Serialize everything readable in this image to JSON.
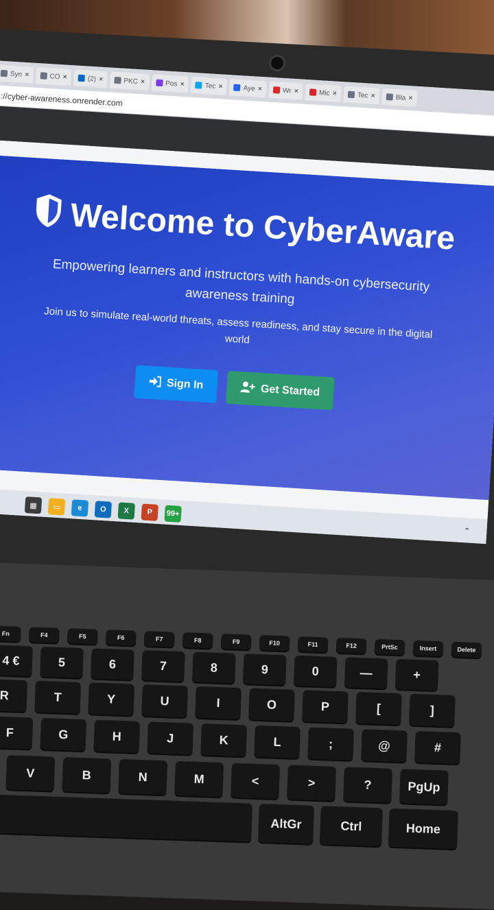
{
  "browser": {
    "tabs": [
      {
        "label": "Syn",
        "color": "#6b7280"
      },
      {
        "label": "CO",
        "color": "#6b7280"
      },
      {
        "label": "(2)",
        "color": "#0a66c2"
      },
      {
        "label": "PKC",
        "color": "#6b7280"
      },
      {
        "label": "Pos",
        "color": "#7c3aed"
      },
      {
        "label": "Tec",
        "color": "#0ea5e9"
      },
      {
        "label": "Aye",
        "color": "#2563eb"
      },
      {
        "label": "Wr",
        "color": "#dc2626"
      },
      {
        "label": "Mic",
        "color": "#dc2626"
      },
      {
        "label": "Tec",
        "color": "#6b7280"
      },
      {
        "label": "Bla",
        "color": "#6b7280"
      }
    ],
    "url": "://cyber-awareness.onrender.com"
  },
  "hero": {
    "title": "Welcome to CyberAware",
    "tagline": "Empowering learners and instructors with hands-on cybersecurity awareness training",
    "subtitle": "Join us to simulate real-world threats, assess readiness, and stay secure in the digital world",
    "sign_in_label": "Sign In",
    "get_started_label": "Get Started",
    "sign_in_color": "#0d8df2",
    "get_started_color": "#2f9a6c"
  },
  "taskbar": {
    "icons": [
      {
        "name": "task-view-icon",
        "color": "#3b3b3b",
        "text": "▦"
      },
      {
        "name": "file-explorer-icon",
        "color": "#f2b01e",
        "text": "▭"
      },
      {
        "name": "edge-icon",
        "color": "#1c8bd6",
        "text": "e"
      },
      {
        "name": "outlook-icon",
        "color": "#0f6cbd",
        "text": "O"
      },
      {
        "name": "excel-icon",
        "color": "#1d7a45",
        "text": "X"
      },
      {
        "name": "powerpoint-icon",
        "color": "#c74325",
        "text": "P"
      },
      {
        "name": "whatsapp-icon",
        "color": "#25a244",
        "text": "99+"
      }
    ]
  },
  "keyboard": {
    "fn_row": [
      "Fn",
      "F4",
      "F5",
      "F6",
      "F7",
      "F8",
      "F9",
      "F10",
      "F11",
      "F12",
      "PrtSc",
      "Insert",
      "Delete"
    ],
    "number_row": [
      "4 €",
      "5",
      "6",
      "7",
      "8",
      "9",
      "0",
      "—",
      "+"
    ],
    "top_row": [
      "R",
      "T",
      "Y",
      "U",
      "I",
      "O",
      "P",
      "[",
      "]"
    ],
    "home_row": [
      "F",
      "G",
      "H",
      "J",
      "K",
      "L",
      ";",
      "@",
      "#"
    ],
    "bottom_row": [
      "V",
      "B",
      "N",
      "M",
      "<",
      ">",
      "?",
      "PgUp"
    ],
    "space_row": [
      "AltGr",
      "Ctrl",
      "Home"
    ]
  }
}
